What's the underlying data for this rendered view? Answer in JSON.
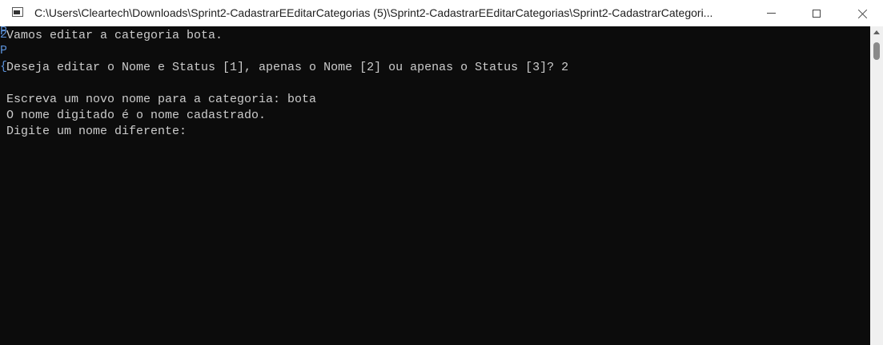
{
  "window": {
    "title": "C:\\Users\\Cleartech\\Downloads\\Sprint2-CadastrarEEditarCategorias (5)\\Sprint2-CadastrarEEditarCategorias\\Sprint2-CadastrarCategori...",
    "icon": "console-app-icon"
  },
  "console": {
    "lines": [
      "Vamos editar a categoria bota.",
      "",
      "Deseja editar o Nome e Status [1], apenas o Nome [2] ou apenas o Status [3]? 2",
      "",
      "Escreva um novo nome para a categoria: bota",
      "O nome digitado é o nome cadastrado.",
      "Digite um nome diferente:"
    ],
    "bleed": [
      "P",
      "2",
      "P",
      "{"
    ]
  },
  "colors": {
    "console_bg": "#0c0c0c",
    "console_text": "#cccccc",
    "titlebar_bg": "#ffffff",
    "scrollbar_bg": "#f0f0f0"
  }
}
